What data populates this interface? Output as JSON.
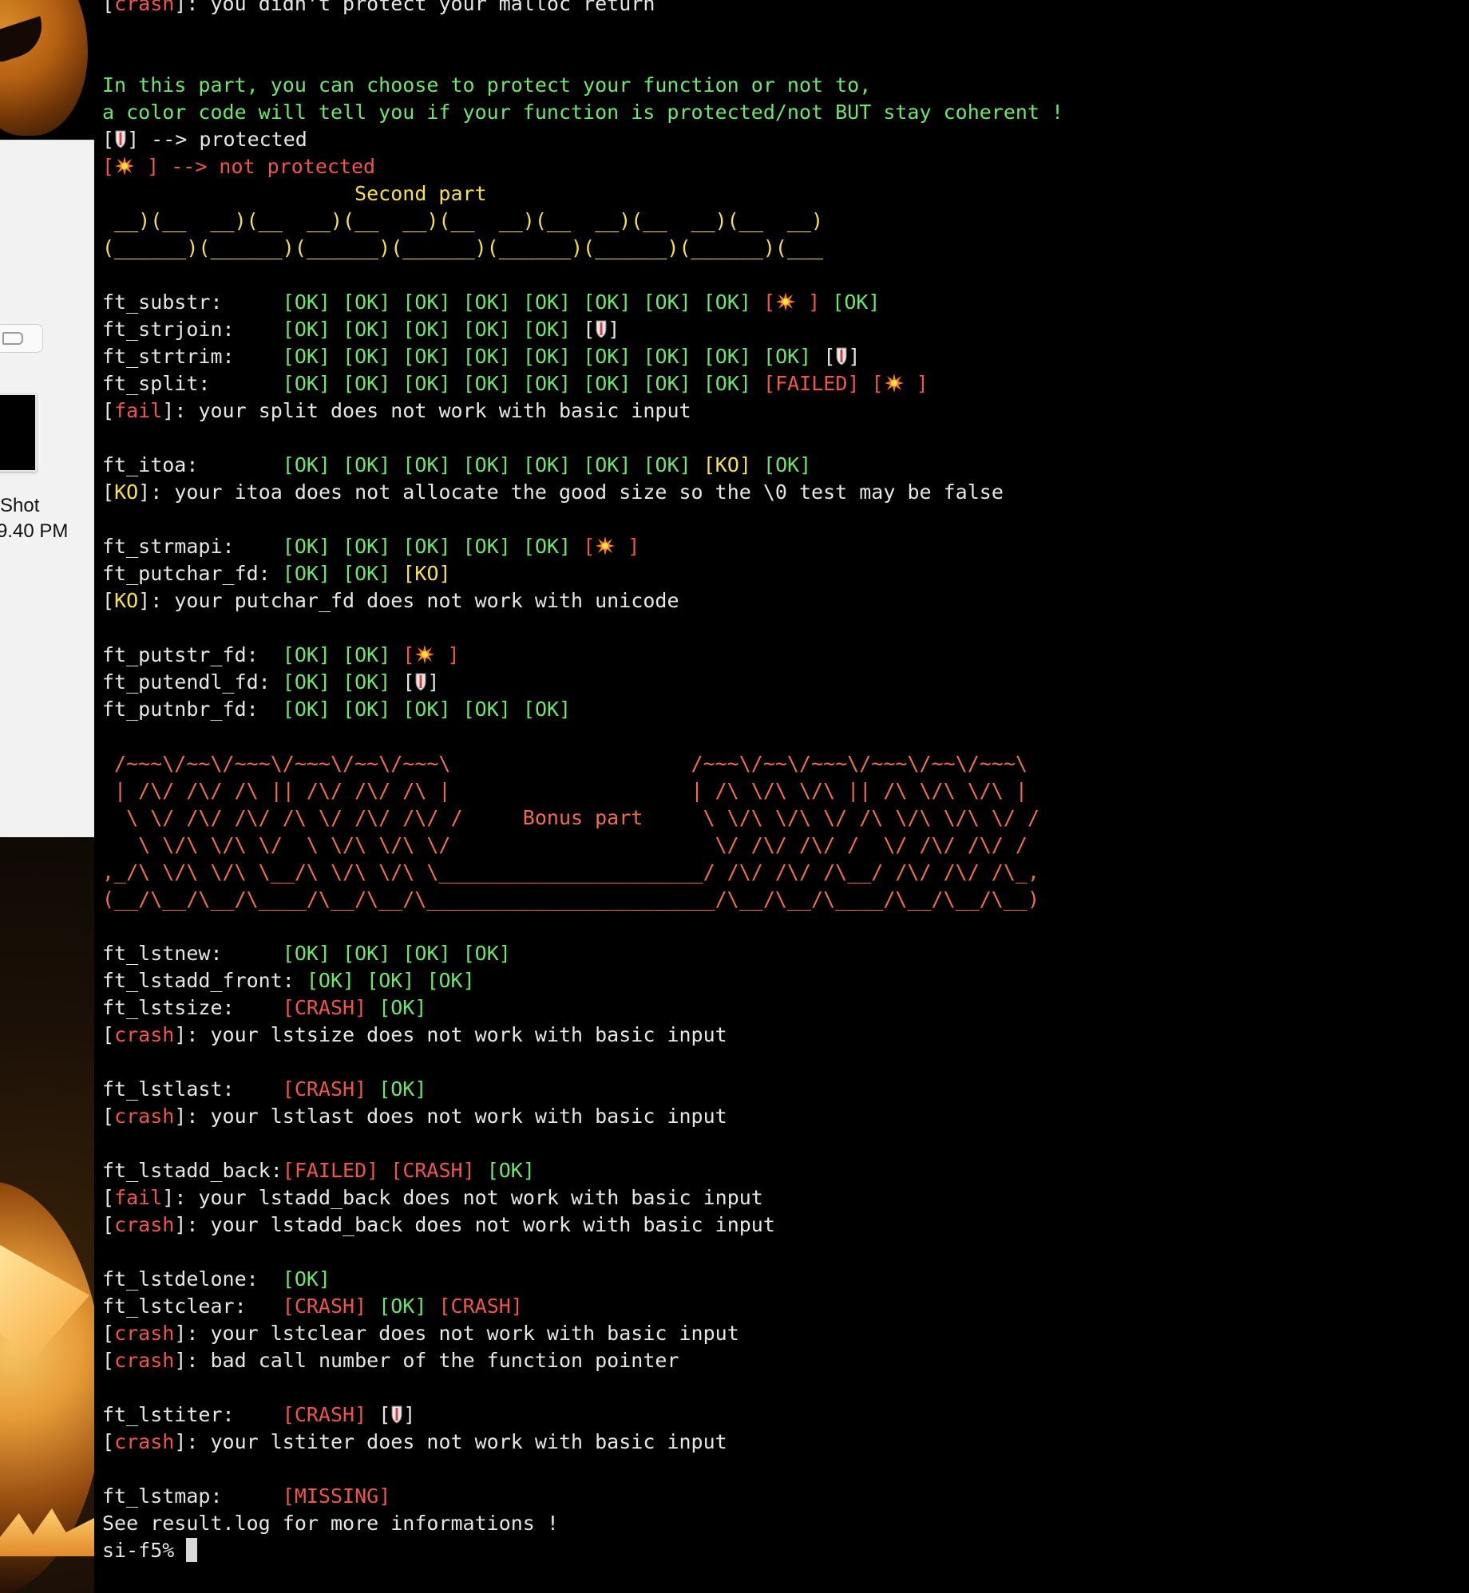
{
  "desktop": {
    "screenshot_name": "Shot",
    "screenshot_time": "9.40 PM"
  },
  "colors": {
    "ok": "#6de66d",
    "fail": "#f0554b",
    "ko": "#f7e04a",
    "ascii_bonus": "#f26c4f",
    "text": "#e6e6e6"
  },
  "terminal": {
    "l1": {
      "bo": "[",
      "tag": "crash",
      "bc": "]",
      "msg": ": you didn't protect your malloc return"
    },
    "blank": "",
    "intro1": "In this part, you can choose to protect your function or not to,",
    "intro2": "a color code will tell you if your function is protected/not BUT stay coherent !",
    "legend_protected": "] --> protected",
    "legend_not": " ] --> not protected",
    "second_title": "                     Second part",
    "ascii2_a": " __)(__  __)(__  __)(__  __)(__  __)(__  __)(__  __)(__  __)",
    "ascii2_b": "(______)(______)(______)(______)(______)(______)(______)(___",
    "ok": "[OK]",
    "ko": "[KO]",
    "failed": "[FAILED]",
    "crash": "[CRASH]",
    "missing": "[MISSING]",
    "sp": " ",
    "br_open": "[",
    "br_close": "]",
    "br_close_sp": " ]",
    "fail_word": "fail",
    "crash_word": "crash",
    "ko_word": "KO",
    "substr": "ft_substr:     ",
    "strjoin": "ft_strjoin:    ",
    "strtrim": "ft_strtrim:    ",
    "split": "ft_split:      ",
    "split_msg": ": your split does not work with basic input",
    "itoa": "ft_itoa:       ",
    "itoa_msg": ": your itoa does not allocate the good size so the \\0 test may be false",
    "strmapi": "ft_strmapi:    ",
    "putchar": "ft_putchar_fd: ",
    "putchar_msg": ": your putchar_fd does not work with unicode",
    "putstr": "ft_putstr_fd:  ",
    "putendl": "ft_putendl_fd: ",
    "putnbr": "ft_putnbr_fd:  ",
    "bonus1": " /~~~\\/~~\\/~~~\\/~~~\\/~~\\/~~~\\                    /~~~\\/~~\\/~~~\\/~~~\\/~~\\/~~~\\",
    "bonus2": " | /\\/ /\\/ /\\ || /\\/ /\\/ /\\ |                    | /\\ \\/\\ \\/\\ || /\\ \\/\\ \\/\\ |",
    "bonus3": "  \\ \\/ /\\/ /\\/ /\\ \\/ /\\/ /\\/ /     Bonus part     \\ \\/\\ \\/\\ \\/ /\\ \\/\\ \\/\\ \\/ /",
    "bonus4": "   \\ \\/\\ \\/\\ \\/  \\ \\/\\ \\/\\ \\/                      \\/ /\\/ /\\/ /  \\/ /\\/ /\\/ /",
    "bonus5": ",_/\\ \\/\\ \\/\\ \\__/\\ \\/\\ \\/\\ \\______________________/ /\\/ /\\/ /\\__/ /\\/ /\\/ /\\_,",
    "bonus6": "(__/\\__/\\__/\\____/\\__/\\__/\\________________________/\\__/\\__/\\____/\\__/\\__/\\__)",
    "lstnew": "ft_lstnew:     ",
    "lstadd_front": "ft_lstadd_front: ",
    "lstsize": "ft_lstsize:    ",
    "lstsize_msg": ": your lstsize does not work with basic input",
    "lstlast": "ft_lstlast:    ",
    "lstlast_msg": ": your lstlast does not work with basic input",
    "lstadd_back": "ft_lstadd_back:",
    "lstadd_back_msg": ": your lstadd_back does not work with basic input",
    "lstdelone": "ft_lstdelone:  ",
    "lstclear": "ft_lstclear:   ",
    "lstclear_msg1": ": your lstclear does not work with basic input",
    "lstclear_msg2": ": bad call number of the function pointer",
    "lstiter": "ft_lstiter:    ",
    "lstiter_msg": ": your lstiter does not work with basic input",
    "lstmap": "ft_lstmap:     ",
    "see_log": "See result.log for more informations !",
    "prompt": "si-f5% "
  }
}
